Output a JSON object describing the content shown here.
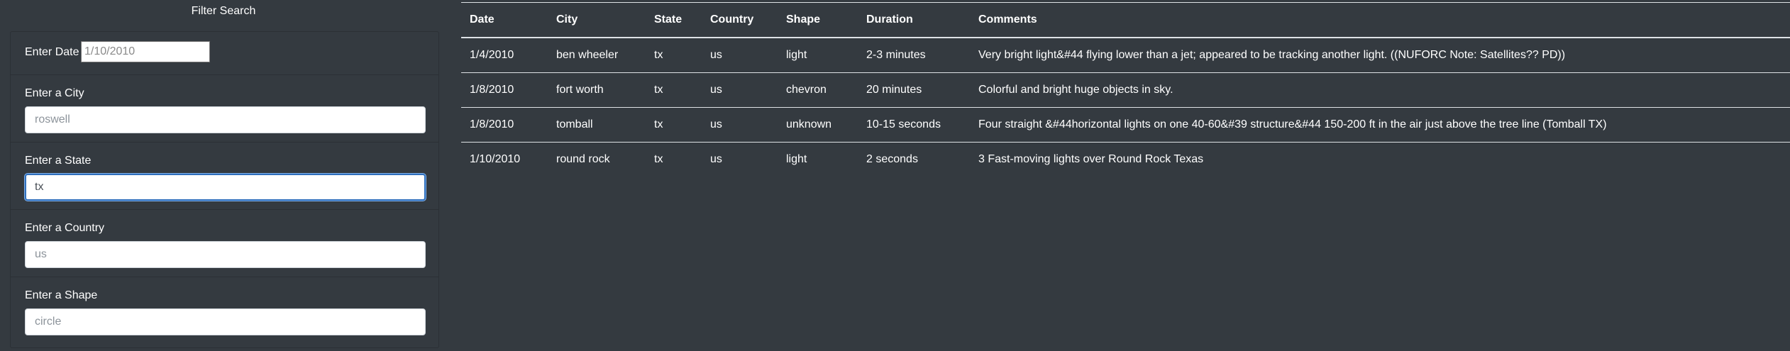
{
  "filter": {
    "title": "Filter Search",
    "date": {
      "label": "Enter Date",
      "placeholder": "1/10/2010",
      "value": ""
    },
    "city": {
      "label": "Enter a City",
      "placeholder": "roswell",
      "value": ""
    },
    "state": {
      "label": "Enter a State",
      "placeholder": "",
      "value": "tx"
    },
    "country": {
      "label": "Enter a Country",
      "placeholder": "us",
      "value": ""
    },
    "shape": {
      "label": "Enter a Shape",
      "placeholder": "circle",
      "value": ""
    }
  },
  "table": {
    "headers": [
      "Date",
      "City",
      "State",
      "Country",
      "Shape",
      "Duration",
      "Comments"
    ],
    "rows": [
      [
        "1/4/2010",
        "ben wheeler",
        "tx",
        "us",
        "light",
        "2-3 minutes",
        "Very bright light&#44 flying lower than a jet; appeared to be tracking another light. ((NUFORC Note: Satellites?? PD))"
      ],
      [
        "1/8/2010",
        "fort worth",
        "tx",
        "us",
        "chevron",
        "20 minutes",
        "Colorful and bright huge objects in sky."
      ],
      [
        "1/8/2010",
        "tomball",
        "tx",
        "us",
        "unknown",
        "10-15 seconds",
        "Four straight &#44horizontal lights on one 40-60&#39 structure&#44 150-200 ft in the air just above the tree line (Tomball TX)"
      ],
      [
        "1/10/2010",
        "round rock",
        "tx",
        "us",
        "light",
        "2 seconds",
        "3 Fast-moving lights over Round Rock Texas"
      ]
    ]
  },
  "colors": {
    "background": "#343a40",
    "text": "#ffffff",
    "focus_border": "#2f6fbd"
  }
}
